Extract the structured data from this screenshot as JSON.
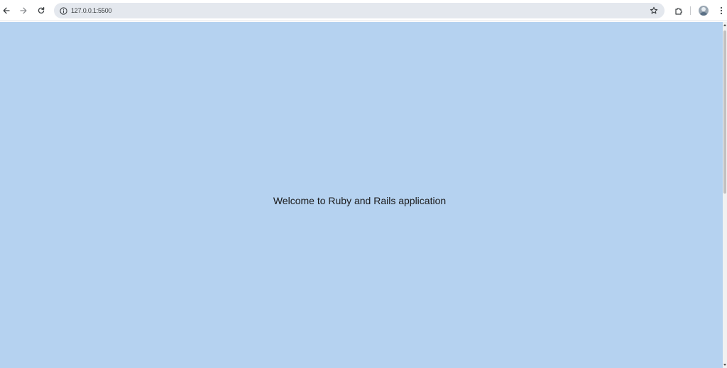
{
  "browser": {
    "url": "127.0.0.1:5500",
    "icons": {
      "back": "arrow-left-icon",
      "forward": "arrow-right-icon",
      "reload": "reload-icon",
      "site_info": "info-circle-icon",
      "bookmark": "star-icon",
      "extensions": "puzzle-icon",
      "profile": "avatar",
      "menu": "kebab-menu-icon"
    }
  },
  "page": {
    "background_color": "#b5d2f0",
    "welcome_text": "Welcome to Ruby and Rails application"
  }
}
